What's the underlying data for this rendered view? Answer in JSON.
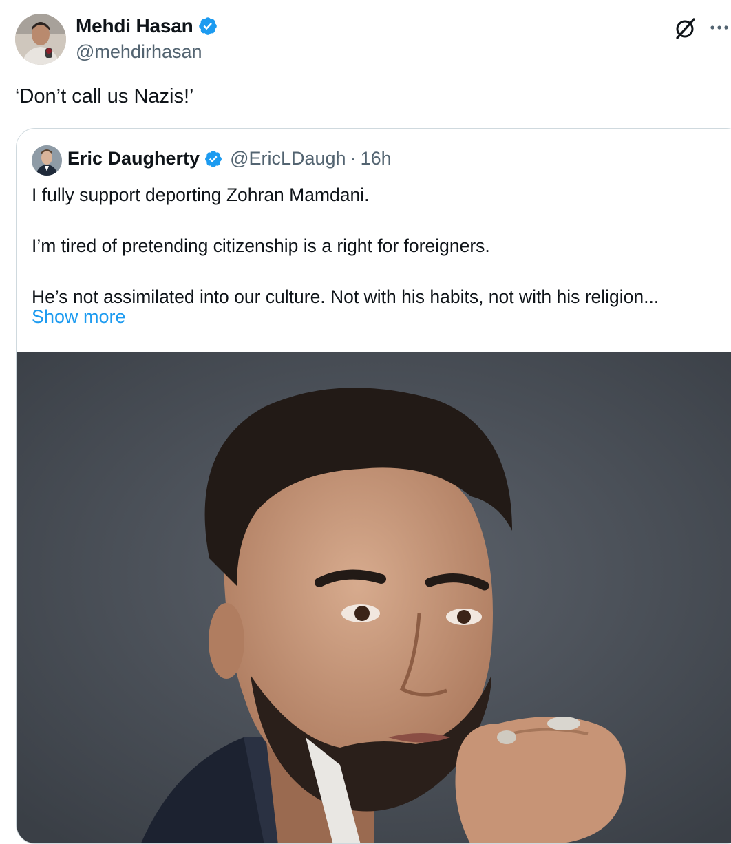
{
  "post": {
    "author_name": "Mehdi Hasan",
    "author_handle": "@mehdirhasan",
    "text": "‘Don’t call us Nazis!’",
    "icons": {
      "verified": "verified-badge-icon",
      "grok": "grok-icon",
      "more": "more-options-icon"
    }
  },
  "quoted": {
    "author_name": "Eric Daugherty",
    "author_handle": "@EricLDaugh",
    "separator": "·",
    "time": "16h",
    "paragraphs": [
      "I fully support deporting Zohran Mamdani.",
      "I’m tired of pretending citizenship is a right for foreigners.",
      "He’s not assimilated into our culture. Not with his habits, not with his religion..."
    ],
    "show_more": "Show more"
  },
  "colors": {
    "text": "#0f1419",
    "secondary": "#536471",
    "link": "#1d9bf0",
    "verified": "#1d9bf0",
    "border": "#cfd9de"
  }
}
